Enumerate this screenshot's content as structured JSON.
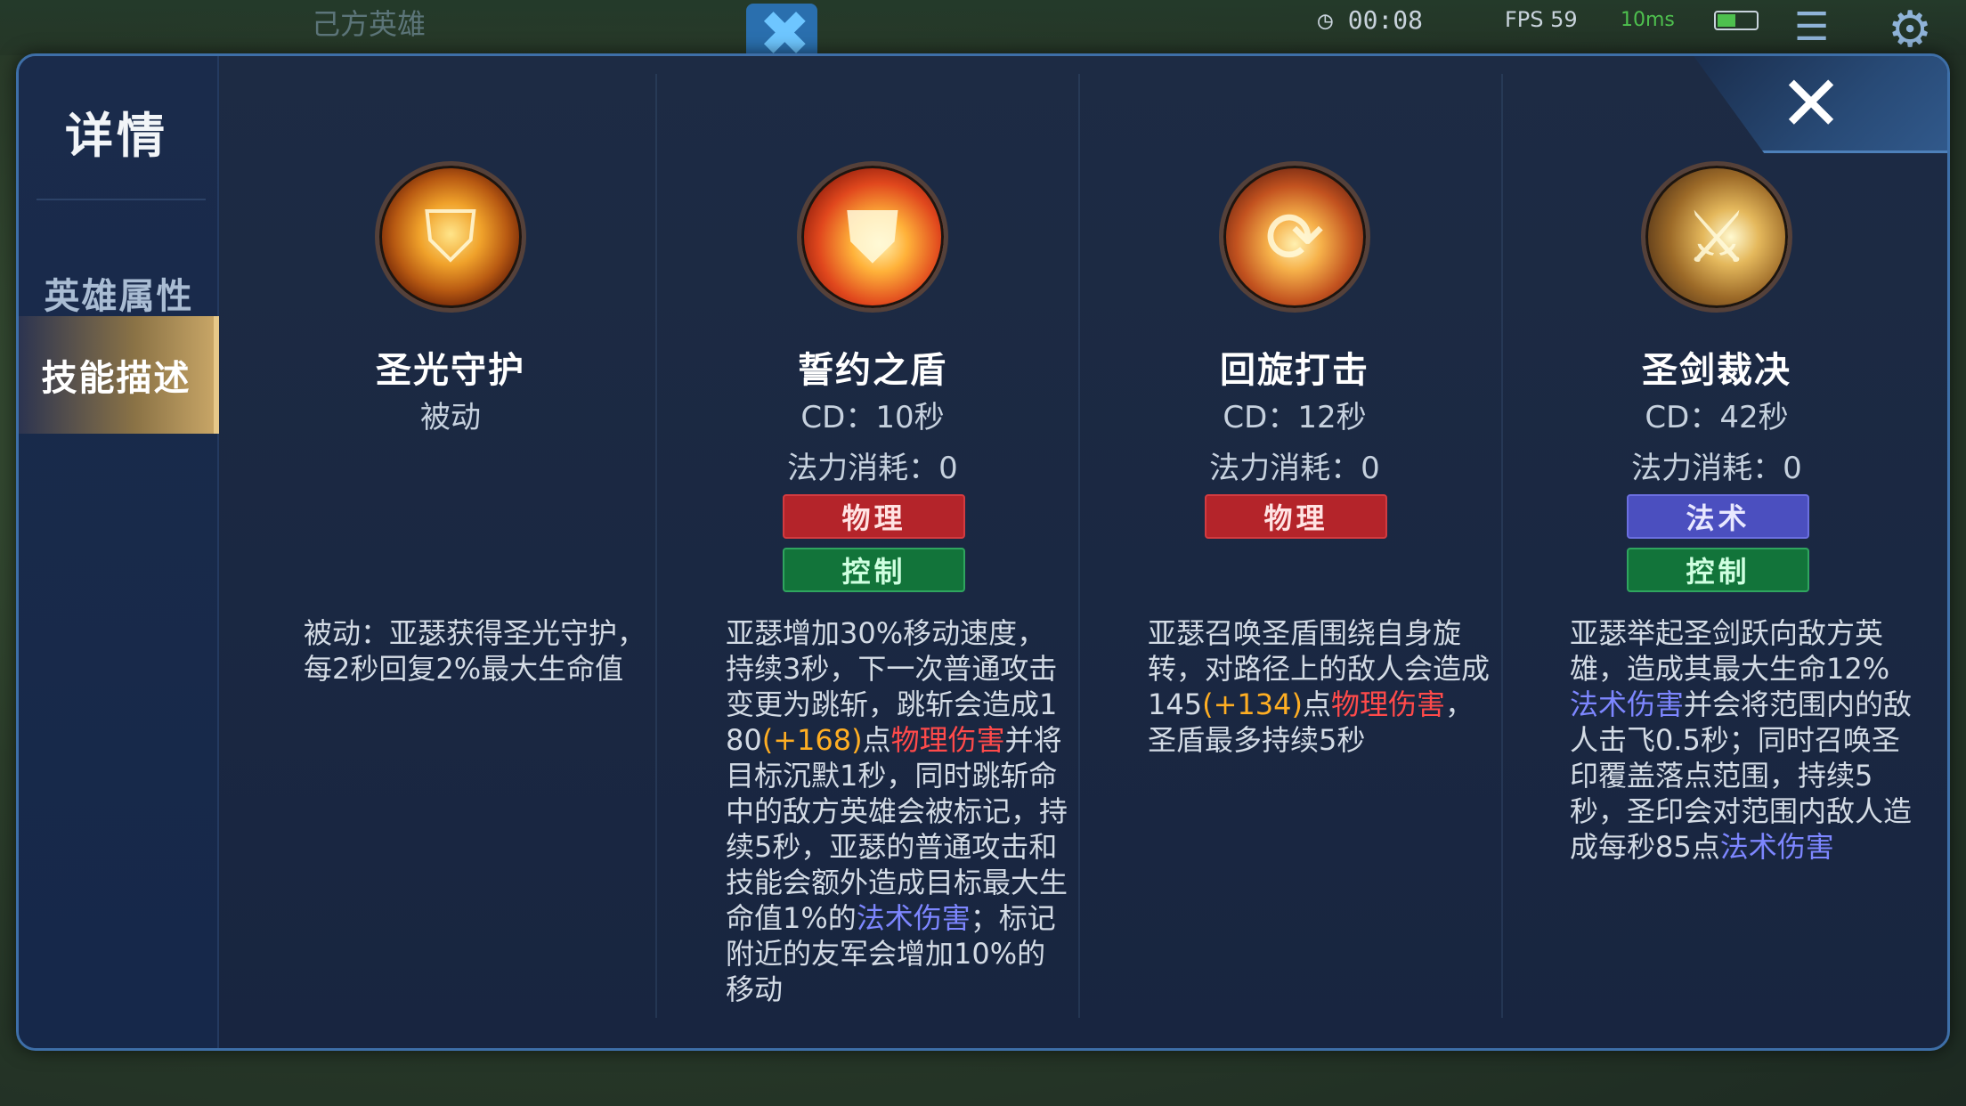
{
  "background_hud": {
    "team_label": "己方英雄",
    "timer": "00:08",
    "fps": "FPS 59",
    "ping": "10ms"
  },
  "sidebar": {
    "title": "详情",
    "items": [
      {
        "label": "英雄属性",
        "active": false
      },
      {
        "label": "技能描述",
        "active": true
      }
    ]
  },
  "close_button": {
    "icon": "close-icon"
  },
  "colors": {
    "accent_gold": "#c7a566",
    "tag_physical": "#b4242a",
    "tag_magic": "#4b4fbf",
    "tag_control": "#12743a",
    "highlight_orange": "#ffae23",
    "highlight_red": "#ff4a4a",
    "highlight_blue": "#7d86ff"
  },
  "skills": [
    {
      "name": "圣光守护",
      "line1": "被动",
      "line2": "",
      "icon": "holy-shield-emblem-icon",
      "tags": [],
      "desc": [
        {
          "t": "被动：亚瑟获得圣光守护，每2秒回复2%最大生命值",
          "c": ""
        }
      ]
    },
    {
      "name": "誓约之盾",
      "line1": "CD：10秒",
      "line2": "法力消耗：0",
      "icon": "flaming-shield-icon",
      "tags": [
        {
          "label": "物理",
          "type": "red"
        },
        {
          "label": "控制",
          "type": "green"
        }
      ],
      "desc": [
        {
          "t": "亚瑟增加30%移动速度，持续3秒，下一次普通攻击变更为跳斩，跳斩会造成180",
          "c": ""
        },
        {
          "t": "(+168)",
          "c": "orange"
        },
        {
          "t": "点",
          "c": ""
        },
        {
          "t": "物理伤害",
          "c": "red"
        },
        {
          "t": "并将目标沉默1秒，同时跳斩命中的敌方英雄会被标记，持续5秒，亚瑟的普通攻击和技能会额外造成目标最大生命值1%的",
          "c": ""
        },
        {
          "t": "法术伤害",
          "c": "blue"
        },
        {
          "t": "；标记附近的友军会增加10%的移动",
          "c": ""
        }
      ]
    },
    {
      "name": "回旋打击",
      "line1": "CD：12秒",
      "line2": "法力消耗：0",
      "icon": "spinning-shield-icon",
      "tags": [
        {
          "label": "物理",
          "type": "red"
        }
      ],
      "desc": [
        {
          "t": "亚瑟召唤圣盾围绕自身旋转，对路径上的敌人会造成145",
          "c": ""
        },
        {
          "t": "(+134)",
          "c": "orange"
        },
        {
          "t": "点",
          "c": ""
        },
        {
          "t": "物理伤害",
          "c": "red"
        },
        {
          "t": "，圣盾最多持续5秒",
          "c": ""
        }
      ]
    },
    {
      "name": "圣剑裁决",
      "line1": "CD：42秒",
      "line2": "法力消耗：0",
      "icon": "holy-sword-knight-icon",
      "tags": [
        {
          "label": "法术",
          "type": "blue"
        },
        {
          "label": "控制",
          "type": "green"
        }
      ],
      "desc": [
        {
          "t": "亚瑟举起圣剑跃向敌方英雄，造成其最大生命12%",
          "c": ""
        },
        {
          "t": "法术伤害",
          "c": "blue"
        },
        {
          "t": "并会将范围内的敌人击飞0.5秒；同时召唤圣印覆盖落点范围，持续5秒，圣印会对范围内敌人造成每秒85点",
          "c": ""
        },
        {
          "t": "法术伤害",
          "c": "blue"
        }
      ]
    }
  ]
}
